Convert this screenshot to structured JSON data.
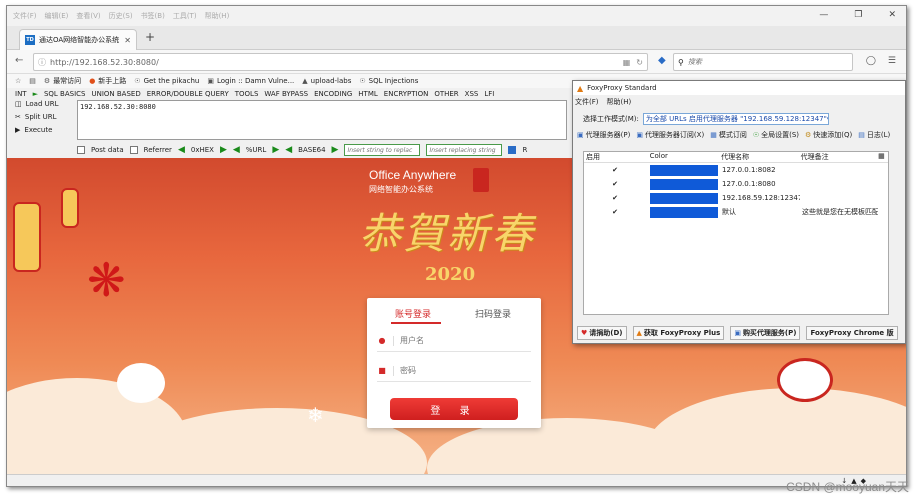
{
  "browser": {
    "menus": [
      "文件(F)",
      "编辑(E)",
      "查看(V)",
      "历史(S)",
      "书签(B)",
      "工具(T)",
      "帮助(H)"
    ],
    "tab_favicon": "TD",
    "tab_title": "通达OA网络智能办公系统",
    "url": "http://192.168.52.30:8080/",
    "search_placeholder": "搜索",
    "bookmarks": [
      "最常访问",
      "新手上路",
      "Get the pikachu",
      "Login :: Damn Vulne...",
      "upload-labs",
      "SQL Injections"
    ]
  },
  "hackbar": {
    "menu": [
      "INT",
      "SQL BASICS",
      "UNION BASED",
      "ERROR/DOUBLE QUERY",
      "TOOLS",
      "WAF BYPASS",
      "ENCODING",
      "HTML",
      "ENCRYPTION",
      "OTHER",
      "XSS",
      "LFI"
    ],
    "load_url": "Load URL",
    "split_url": "Split URL",
    "execute": "Execute",
    "url_text": "192.168.52.30:8080",
    "post_data": "Post data",
    "referrer": "Referrer",
    "hex": "0xHEX",
    "url_enc": "%URL",
    "base64": "BASE64",
    "insert_string_placeholder": "Insert string to replac",
    "insert_replacing_placeholder": "Insert replacing string",
    "r_label": "R"
  },
  "page": {
    "brand_en": "Office Anywhere",
    "brand_cn": "网络智能办公系统",
    "greeting": "恭賀新春",
    "year": "2020",
    "login": {
      "tab_account": "账号登录",
      "tab_scan": "扫码登录",
      "username_placeholder": "用户名",
      "password_placeholder": "密码",
      "submit": "登 录"
    }
  },
  "foxyproxy": {
    "title": "FoxyProxy Standard",
    "menu": [
      "文件(F)",
      "帮助(H)"
    ],
    "mode_label": "选择工作模式(M):",
    "mode_value": "为全部 URLs 启用代理服务器 \"192.168.59.128:12347\"",
    "tools": [
      "代理服务器(P)",
      "代理服务器订阅(X)",
      "模式订阅",
      "全局设置(S)",
      "快速添加(Q)",
      "日志(L)"
    ],
    "table_headers": [
      "启用",
      "Color",
      "代理名称",
      "代理备注"
    ],
    "rows": [
      {
        "enabled": "✔",
        "color": "#0f5ad8",
        "name": "127.0.0.1:8082",
        "note": ""
      },
      {
        "enabled": "✔",
        "color": "#0f5ad8",
        "name": "127.0.0.1:8080",
        "note": ""
      },
      {
        "enabled": "✔",
        "color": "#0f5ad8",
        "name": "192.168.59.128:12347",
        "note": ""
      },
      {
        "enabled": "✔",
        "color": "#0f5ad8",
        "name": "默认",
        "note": "这些就是您在无模板匹配..."
      }
    ],
    "bottom_buttons": [
      "请捐助(D)",
      "获取 FoxyProxy Plus",
      "购买代理服务(P)",
      "FoxyProxy Chrome 版"
    ]
  },
  "watermark": "CSDN @mooyuan天天"
}
